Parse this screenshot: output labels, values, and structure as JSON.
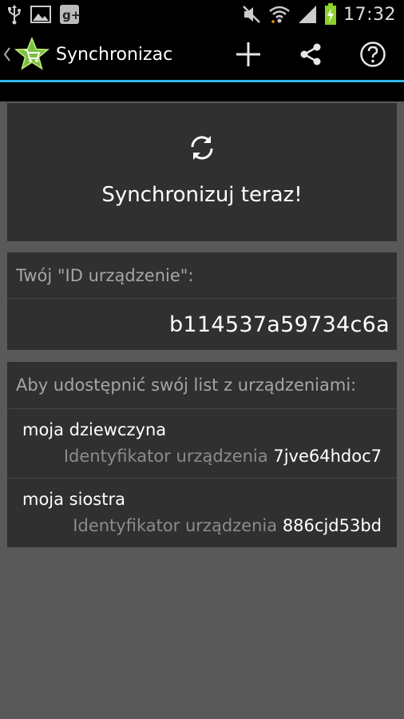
{
  "status_bar": {
    "time": "17:32",
    "icons": [
      "usb-icon",
      "gallery-icon",
      "google-plus-icon",
      "mute-icon",
      "wifi-icon",
      "signal-icon",
      "battery-charging-icon"
    ]
  },
  "action_bar": {
    "title": "Synchronizac",
    "actions": [
      "add-icon",
      "share-icon",
      "help-icon"
    ],
    "accent_color": "#33b5e5",
    "logo_color": "#7ac143"
  },
  "sync": {
    "label": "Synchronizuj teraz!"
  },
  "device_id": {
    "header": "Twój \"ID urządzenie\":",
    "value": "b114537a59734c6a"
  },
  "share": {
    "header": "Aby udostępnić swój list z urządzeniami:",
    "devices": [
      {
        "name": "moja dziewczyna",
        "id_label": "Identyfikator urządzenia",
        "id": "7jve64hdoc7"
      },
      {
        "name": "moja siostra",
        "id_label": "Identyfikator urządzenia",
        "id": "886cjd53bd"
      }
    ]
  }
}
